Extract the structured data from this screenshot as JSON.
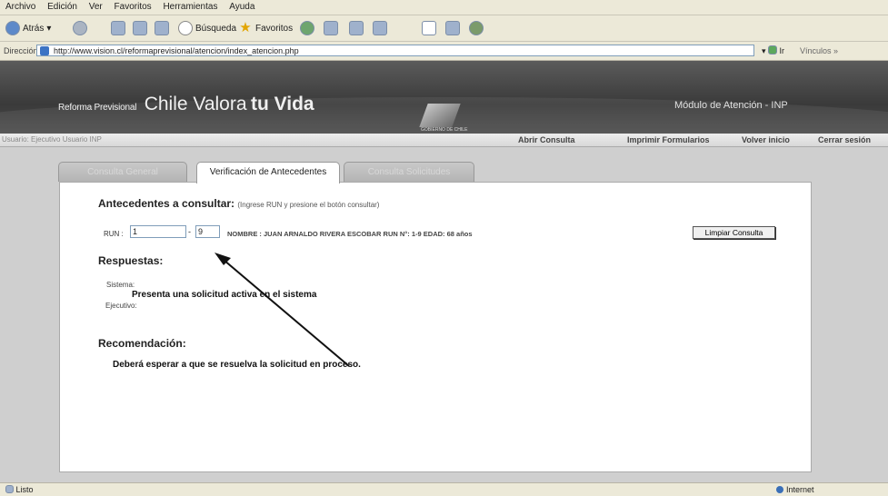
{
  "menu": [
    "Archivo",
    "Edición",
    "Ver",
    "Favoritos",
    "Herramientas",
    "Ayuda"
  ],
  "toolbar": {
    "back": "Atrás",
    "search": "Búsqueda",
    "favorites": "Favoritos"
  },
  "address": {
    "label": "Dirección",
    "url": "http://www.vision.cl/reformaprevisional/atencion/index_atencion.php",
    "go": "Ir",
    "links": "Vínculos"
  },
  "banner": {
    "brand_small": "Reforma Previsional",
    "brand_main": "Chile Valora",
    "brand_bold": "tu Vida",
    "gov": "GOBIERNO DE CHILE",
    "module": "Módulo de Atención - INP"
  },
  "nav": {
    "left_text": "Usuario: Ejecutivo Usuario INP",
    "links": [
      "Abrir Consulta",
      "Imprimir Formularios",
      "Volver inicio",
      "Cerrar sesión"
    ]
  },
  "tabs": [
    "Consulta General",
    "Verificación de Antecedentes",
    "Consulta Solicitudes"
  ],
  "form": {
    "heading": "Antecedentes a consultar:",
    "hint": "(Ingrese RUN y presione el botón consultar)",
    "run_label": "RUN :",
    "run_value": "1",
    "dash": "-",
    "dv_value": "9",
    "info": "NOMBRE : JUAN ARNALDO RIVERA ESCOBAR  RUN N°: 1-9  EDAD: 68 años",
    "clear_button": "Limpiar Consulta"
  },
  "respuestas": {
    "heading": "Respuestas:",
    "sistema_label": "Sistema:",
    "sistema_text": "Presenta una solicitud activa en el sistema",
    "ejecutivo_label": "Ejecutivo:"
  },
  "recomendacion": {
    "heading": "Recomendación:",
    "text": "Deberá esperar a que se resuelva la solicitud en proceso."
  },
  "status": {
    "left": "Listo",
    "right": "Internet"
  }
}
